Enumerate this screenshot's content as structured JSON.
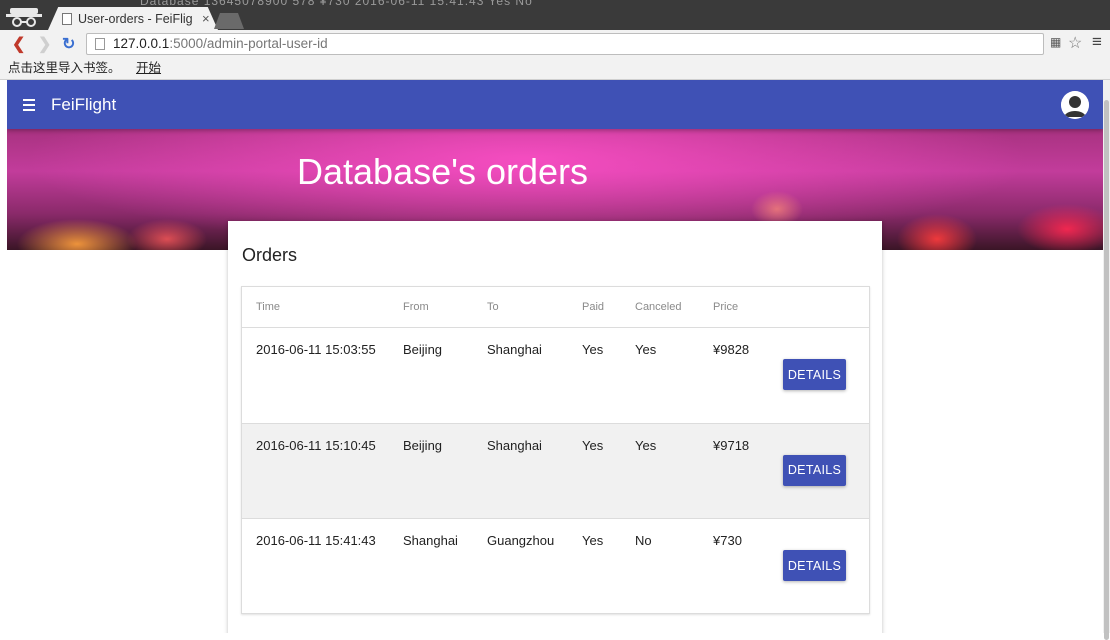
{
  "browser": {
    "background_text": "Database 13645078900 578 ¥730 2016-06-11 15:41:43 Yes No",
    "tab_title": "User-orders - FeiFlig",
    "tab_close": "×",
    "url_host": "127.0.0.1",
    "url_path": ":5000/admin-portal-user-id",
    "bookmarks_prompt": "点击这里导入书签。",
    "bookmarks_link": "开始"
  },
  "app": {
    "title": "FeiFlight",
    "accent_color": "#3f51b5"
  },
  "hero": {
    "title": "Database's orders"
  },
  "orders": {
    "card_title": "Orders",
    "columns": {
      "time": "Time",
      "from": "From",
      "to": "To",
      "paid": "Paid",
      "canceled": "Canceled",
      "price": "Price"
    },
    "rows": [
      {
        "time": "2016-06-11 15:03:55",
        "from": "Beijing",
        "to": "Shanghai",
        "paid": "Yes",
        "canceled": "Yes",
        "price": "¥9828",
        "action": "DETAILS"
      },
      {
        "time": "2016-06-11 15:10:45",
        "from": "Beijing",
        "to": "Shanghai",
        "paid": "Yes",
        "canceled": "Yes",
        "price": "¥9718",
        "action": "DETAILS"
      },
      {
        "time": "2016-06-11 15:41:43",
        "from": "Shanghai",
        "to": "Guangzhou",
        "paid": "Yes",
        "canceled": "No",
        "price": "¥730",
        "action": "DETAILS"
      }
    ]
  }
}
